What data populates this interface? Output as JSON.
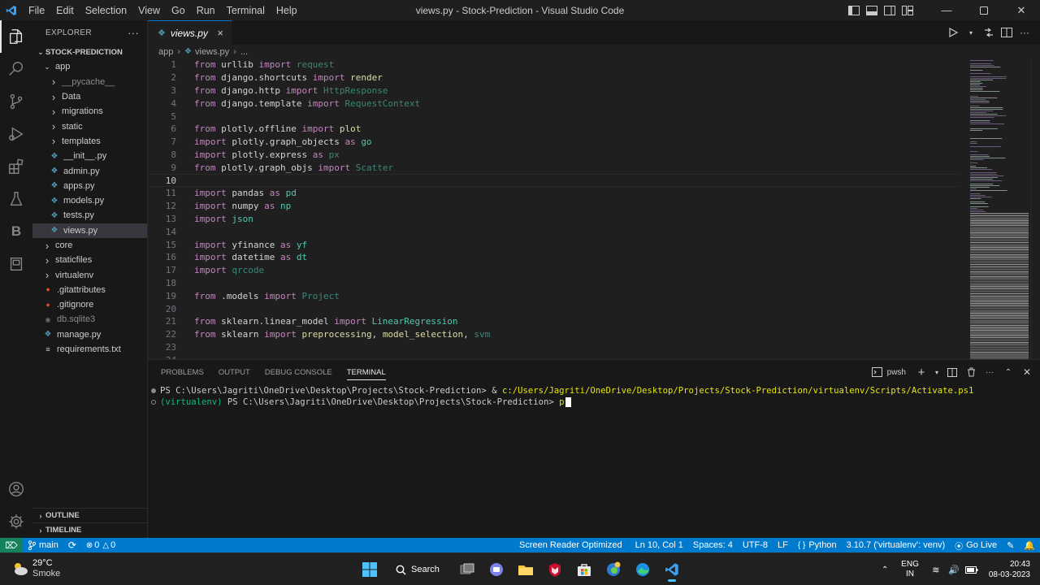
{
  "titlebar": {
    "menu": [
      "File",
      "Edit",
      "Selection",
      "View",
      "Go",
      "Run",
      "Terminal",
      "Help"
    ],
    "title": "views.py - Stock-Prediction - Visual Studio Code"
  },
  "explorer": {
    "header": "EXPLORER",
    "more": "···",
    "root": "STOCK-PREDICTION",
    "items": [
      {
        "label": "app",
        "depth": 1,
        "chevron": "open"
      },
      {
        "label": "__pycache__",
        "depth": 2,
        "chevron": "closed",
        "dim": true
      },
      {
        "label": "Data",
        "depth": 2,
        "chevron": "closed"
      },
      {
        "label": "migrations",
        "depth": 2,
        "chevron": "closed"
      },
      {
        "label": "static",
        "depth": 2,
        "chevron": "closed"
      },
      {
        "label": "templates",
        "depth": 2,
        "chevron": "closed"
      },
      {
        "label": "__init__.py",
        "depth": 2,
        "icon": "python-file-icon"
      },
      {
        "label": "admin.py",
        "depth": 2,
        "icon": "python-file-icon"
      },
      {
        "label": "apps.py",
        "depth": 2,
        "icon": "python-file-icon"
      },
      {
        "label": "models.py",
        "depth": 2,
        "icon": "python-file-icon"
      },
      {
        "label": "tests.py",
        "depth": 2,
        "icon": "python-file-icon"
      },
      {
        "label": "views.py",
        "depth": 2,
        "icon": "python-file-icon",
        "selected": true
      },
      {
        "label": "core",
        "depth": 1,
        "chevron": "closed"
      },
      {
        "label": "staticfiles",
        "depth": 1,
        "chevron": "closed"
      },
      {
        "label": "virtualenv",
        "depth": 1,
        "chevron": "closed"
      },
      {
        "label": ".gitattributes",
        "depth": 1,
        "icon": "git-file-icon"
      },
      {
        "label": ".gitignore",
        "depth": 1,
        "icon": "git-file-icon"
      },
      {
        "label": "db.sqlite3",
        "depth": 1,
        "icon": "database-file-icon",
        "dim": true
      },
      {
        "label": "manage.py",
        "depth": 1,
        "icon": "python-file-icon"
      },
      {
        "label": "requirements.txt",
        "depth": 1,
        "icon": "text-file-icon"
      }
    ],
    "outline": "OUTLINE",
    "timeline": "TIMELINE"
  },
  "tab": {
    "label": "views.py",
    "close": "×"
  },
  "breadcrumb": {
    "folder": "app",
    "file": "views.py",
    "more": "..."
  },
  "editor": {
    "current_line": 10,
    "lines": [
      {
        "n": "1",
        "tokens": [
          [
            "kw",
            "from "
          ],
          [
            "mod",
            "urllib "
          ],
          [
            "kw",
            "import "
          ],
          [
            "dim",
            "request"
          ]
        ]
      },
      {
        "n": "2",
        "tokens": [
          [
            "kw",
            "from "
          ],
          [
            "mod",
            "django.shortcuts "
          ],
          [
            "kw",
            "import "
          ],
          [
            "fn",
            "render"
          ]
        ]
      },
      {
        "n": "3",
        "tokens": [
          [
            "kw",
            "from "
          ],
          [
            "mod",
            "django.http "
          ],
          [
            "kw",
            "import "
          ],
          [
            "dim",
            "HttpResponse"
          ]
        ]
      },
      {
        "n": "4",
        "tokens": [
          [
            "kw",
            "from "
          ],
          [
            "mod",
            "django.template "
          ],
          [
            "kw",
            "import "
          ],
          [
            "dim",
            "RequestContext"
          ]
        ]
      },
      {
        "n": "5",
        "tokens": []
      },
      {
        "n": "6",
        "tokens": [
          [
            "kw",
            "from "
          ],
          [
            "mod",
            "plotly.offline "
          ],
          [
            "kw",
            "import "
          ],
          [
            "fn",
            "plot"
          ]
        ]
      },
      {
        "n": "7",
        "tokens": [
          [
            "kw",
            "import "
          ],
          [
            "mod",
            "plotly.graph_objects "
          ],
          [
            "kw",
            "as "
          ],
          [
            "cls",
            "go"
          ]
        ]
      },
      {
        "n": "8",
        "tokens": [
          [
            "kw",
            "import "
          ],
          [
            "mod",
            "plotly.express "
          ],
          [
            "kw",
            "as "
          ],
          [
            "dim",
            "px"
          ]
        ]
      },
      {
        "n": "9",
        "tokens": [
          [
            "kw",
            "from "
          ],
          [
            "mod",
            "plotly.graph_objs "
          ],
          [
            "kw",
            "import "
          ],
          [
            "dim",
            "Scatter"
          ]
        ]
      },
      {
        "n": "10",
        "tokens": []
      },
      {
        "n": "11",
        "tokens": [
          [
            "kw",
            "import "
          ],
          [
            "mod",
            "pandas "
          ],
          [
            "kw",
            "as "
          ],
          [
            "cls",
            "pd"
          ]
        ]
      },
      {
        "n": "12",
        "tokens": [
          [
            "kw",
            "import "
          ],
          [
            "mod",
            "numpy "
          ],
          [
            "kw",
            "as "
          ],
          [
            "cls",
            "np"
          ]
        ]
      },
      {
        "n": "13",
        "tokens": [
          [
            "kw",
            "import "
          ],
          [
            "cls",
            "json"
          ]
        ]
      },
      {
        "n": "14",
        "tokens": []
      },
      {
        "n": "15",
        "tokens": [
          [
            "kw",
            "import "
          ],
          [
            "mod",
            "yfinance "
          ],
          [
            "kw",
            "as "
          ],
          [
            "cls",
            "yf"
          ]
        ]
      },
      {
        "n": "16",
        "tokens": [
          [
            "kw",
            "import "
          ],
          [
            "mod",
            "datetime "
          ],
          [
            "kw",
            "as "
          ],
          [
            "cls",
            "dt"
          ]
        ]
      },
      {
        "n": "17",
        "tokens": [
          [
            "kw",
            "import "
          ],
          [
            "dim",
            "qrcode"
          ]
        ]
      },
      {
        "n": "18",
        "tokens": []
      },
      {
        "n": "19",
        "tokens": [
          [
            "kw",
            "from "
          ],
          [
            "mod",
            ".models "
          ],
          [
            "kw",
            "import "
          ],
          [
            "dim",
            "Project"
          ]
        ]
      },
      {
        "n": "20",
        "tokens": []
      },
      {
        "n": "21",
        "tokens": [
          [
            "kw",
            "from "
          ],
          [
            "mod",
            "sklearn.linear_model "
          ],
          [
            "kw",
            "import "
          ],
          [
            "cls",
            "LinearRegression"
          ]
        ]
      },
      {
        "n": "22",
        "tokens": [
          [
            "kw",
            "from "
          ],
          [
            "mod",
            "sklearn "
          ],
          [
            "kw",
            "import "
          ],
          [
            "fn",
            "preprocessing"
          ],
          [
            "mod",
            ", "
          ],
          [
            "fn",
            "model_selection"
          ],
          [
            "mod",
            ", "
          ],
          [
            "dim",
            "svm"
          ]
        ]
      },
      {
        "n": "23",
        "tokens": []
      },
      {
        "n": "24",
        "tokens": []
      }
    ]
  },
  "panel": {
    "tabs": [
      "PROBLEMS",
      "OUTPUT",
      "DEBUG CONSOLE",
      "TERMINAL"
    ],
    "active_tab": "TERMINAL",
    "shell": "pwsh",
    "terminal": {
      "line1_prompt": "PS C:\\Users\\Jagriti\\OneDrive\\Desktop\\Projects\\Stock-Prediction> & ",
      "line1_cmd": "c:/Users/Jagriti/OneDrive/Desktop/Projects/Stock-Prediction/virtualenv/Scripts/Activate.ps1",
      "line2_env": "(virtualenv) ",
      "line2_prompt": "PS C:\\Users\\Jagriti\\OneDrive\\Desktop\\Projects\\Stock-Prediction> ",
      "line2_input": "p"
    }
  },
  "statusbar": {
    "branch": "main",
    "errors": "0",
    "warnings": "0",
    "screen_reader": "Screen Reader Optimized",
    "position": "Ln 10, Col 1",
    "spaces": "Spaces: 4",
    "encoding": "UTF-8",
    "eol": "LF",
    "language": "Python",
    "interpreter": "3.10.7 ('virtualenv': venv)",
    "golive": "Go Live"
  },
  "taskbar": {
    "temperature": "29°C",
    "condition": "Smoke",
    "search": "Search",
    "lang_top": "ENG",
    "lang_bottom": "IN",
    "time": "20:43",
    "date": "08-03-2023"
  },
  "colors": {
    "accent": "#007acc",
    "keyword": "#c586c0",
    "type": "#4ec9b0",
    "function": "#dcdcaa"
  }
}
